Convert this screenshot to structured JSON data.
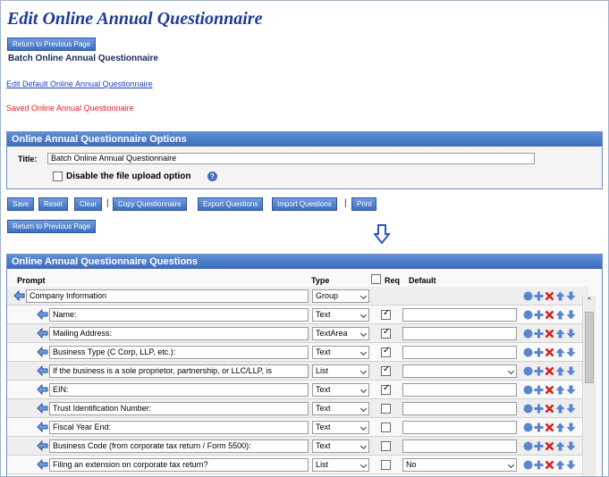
{
  "page": {
    "title": "Edit Online Annual Questionnaire",
    "return_label": "Return to Previous Page",
    "subtitle": "Batch Online Annual Questionnaire",
    "edit_default_link": "Edit Default Online Annual Questionnaire",
    "saved_message": "Saved Online Annual Questionnaire"
  },
  "options_panel": {
    "header": "Online Annual Questionnaire Options",
    "title_label": "Title:",
    "title_value": "Batch Online Annual Questionnaire",
    "disable_upload_label": "Disable the file upload option",
    "disable_upload_checked": false
  },
  "toolbar": {
    "save": "Save",
    "reset": "Reset",
    "clear": "Clear",
    "copy": "Copy Questionnaire",
    "export": "Export Questions",
    "import": "Import Questions",
    "print": "Print",
    "separator": "|"
  },
  "questions_panel": {
    "header": "Online Annual Questionnaire Questions",
    "col_prompt": "Prompt",
    "col_type": "Type",
    "col_req": "Req",
    "col_default": "Default"
  },
  "colors": {
    "accent": "#3c6bb9",
    "title": "#1f3a93",
    "saved": "#e02020",
    "delete": "#d42020"
  },
  "rows": [
    {
      "prompt": "Company Information",
      "type": "Group",
      "req": null,
      "default": null
    },
    {
      "prompt": "Name:",
      "type": "Text",
      "req": true,
      "default": ""
    },
    {
      "prompt": "Mailing Address:",
      "type": "TextArea",
      "req": true,
      "default": ""
    },
    {
      "prompt": "Business Type (C Corp, LLP, etc.):",
      "type": "Text",
      "req": true,
      "default": ""
    },
    {
      "prompt": "If the business is a sole proprietor, partnership, or LLC/LLP, is",
      "type": "List",
      "req": true,
      "default": ""
    },
    {
      "prompt": "EIN:",
      "type": "Text",
      "req": true,
      "default": ""
    },
    {
      "prompt": "Trust Identification Number:",
      "type": "Text",
      "req": false,
      "default": ""
    },
    {
      "prompt": "Fiscal Year End:",
      "type": "Text",
      "req": false,
      "default": ""
    },
    {
      "prompt": "Business Code (from corporate tax return / Form 5500):",
      "type": "Text",
      "req": false,
      "default": ""
    },
    {
      "prompt": "Filing an extension on corporate tax return?",
      "type": "List",
      "req": false,
      "default": "No"
    }
  ]
}
